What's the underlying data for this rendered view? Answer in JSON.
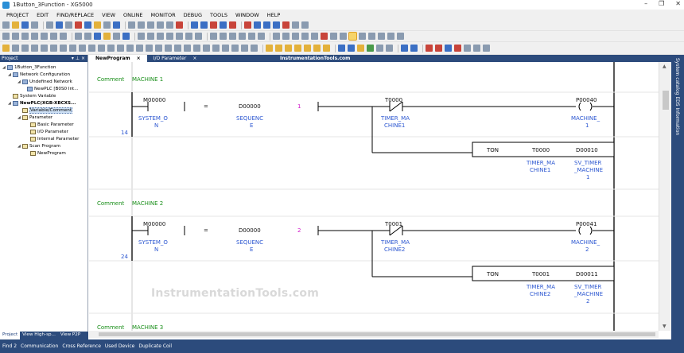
{
  "window": {
    "title": "1Button_3Function - XG5000"
  },
  "menu": [
    "PROJECT",
    "EDIT",
    "FIND/REPLACE",
    "VIEW",
    "ONLINE",
    "MONITOR",
    "DEBUG",
    "TOOLS",
    "WINDOW",
    "HELP"
  ],
  "project_panel": {
    "header": "Project",
    "tree": [
      {
        "label": "1Button_3Function",
        "level": 0,
        "icon": "project-icon"
      },
      {
        "label": "Network Configuration",
        "level": 1,
        "icon": "network-icon"
      },
      {
        "label": "Undefined Network",
        "level": 2,
        "icon": "network-icon"
      },
      {
        "label": "NewPLC [B0S0 Int...",
        "level": 3,
        "icon": "plc-icon"
      },
      {
        "label": "System Variable",
        "level": 1,
        "icon": "variable-icon"
      },
      {
        "label": "NewPLC(XGB-XBCXS...",
        "level": 1,
        "icon": "plc-icon",
        "bold": true
      },
      {
        "label": "Variable/Comment",
        "level": 2,
        "icon": "variable-icon",
        "selected": true
      },
      {
        "label": "Parameter",
        "level": 2,
        "icon": "folder-icon"
      },
      {
        "label": "Basic Parameter",
        "level": 3,
        "icon": "parameter-icon"
      },
      {
        "label": "I/O Parameter",
        "level": 3,
        "icon": "parameter-icon"
      },
      {
        "label": "Internal Parameter",
        "level": 3,
        "icon": "parameter-icon"
      },
      {
        "label": "Scan Program",
        "level": 2,
        "icon": "folder-icon"
      },
      {
        "label": "NewProgram",
        "level": 3,
        "icon": "program-icon"
      }
    ],
    "tabs": [
      "Project",
      "View High-sp...",
      "View P2P"
    ]
  },
  "doc_tabs": [
    {
      "label": "NewProgram",
      "active": true
    },
    {
      "label": "I/O Parameter",
      "active": false
    }
  ],
  "watermark_top": "InstrumentationTools.com",
  "ladder": {
    "rungs": [
      {
        "comment_label": "Comment",
        "comment": "MACHINE 1",
        "step": "14",
        "contact1_addr": "M00000",
        "contact1_name_a": "SYSTEM_O",
        "contact1_name_b": "N",
        "compare_op": "=",
        "compare_dev": "D00000",
        "compare_dev_a": "SEQUENC",
        "compare_dev_b": "E",
        "compare_val": "1",
        "contact2_addr": "T0000",
        "contact2_name_a": "TIMER_MA",
        "contact2_name_b": "CHINE1",
        "coil_addr": "P00040",
        "coil_name_a": "MACHINE_",
        "coil_name_b": "1",
        "ton": "TON",
        "timer": "T0000",
        "timer_a": "TIMER_MA",
        "timer_b": "CHINE1",
        "preset": "D00010",
        "preset_a": "SV_TIMER",
        "preset_b": "_MACHINE",
        "preset_c": "1"
      },
      {
        "comment_label": "Comment",
        "comment": "MACHINE 2",
        "step": "24",
        "contact1_addr": "M00000",
        "contact1_name_a": "SYSTEM_O",
        "contact1_name_b": "N",
        "compare_op": "=",
        "compare_dev": "D00000",
        "compare_dev_a": "SEQUENC",
        "compare_dev_b": "E",
        "compare_val": "2",
        "contact2_addr": "T0001",
        "contact2_name_a": "TIMER_MA",
        "contact2_name_b": "CHINE2",
        "coil_addr": "P00041",
        "coil_name_a": "MACHINE_",
        "coil_name_b": "2",
        "ton": "TON",
        "timer": "T0001",
        "timer_a": "TIMER_MA",
        "timer_b": "CHINE2",
        "preset": "D00011",
        "preset_a": "SV_TIMER",
        "preset_b": "_MACHINE",
        "preset_c": "2"
      }
    ],
    "next_comment_label": "Comment",
    "next_comment": "MACHINE 3"
  },
  "watermark": "InstrumentationTools.com",
  "right_panel": "System catalog  EDS Information",
  "status": [
    "Find 2",
    "Communication",
    "Cross Reference",
    "Used Device",
    "Duplicate Coil"
  ]
}
